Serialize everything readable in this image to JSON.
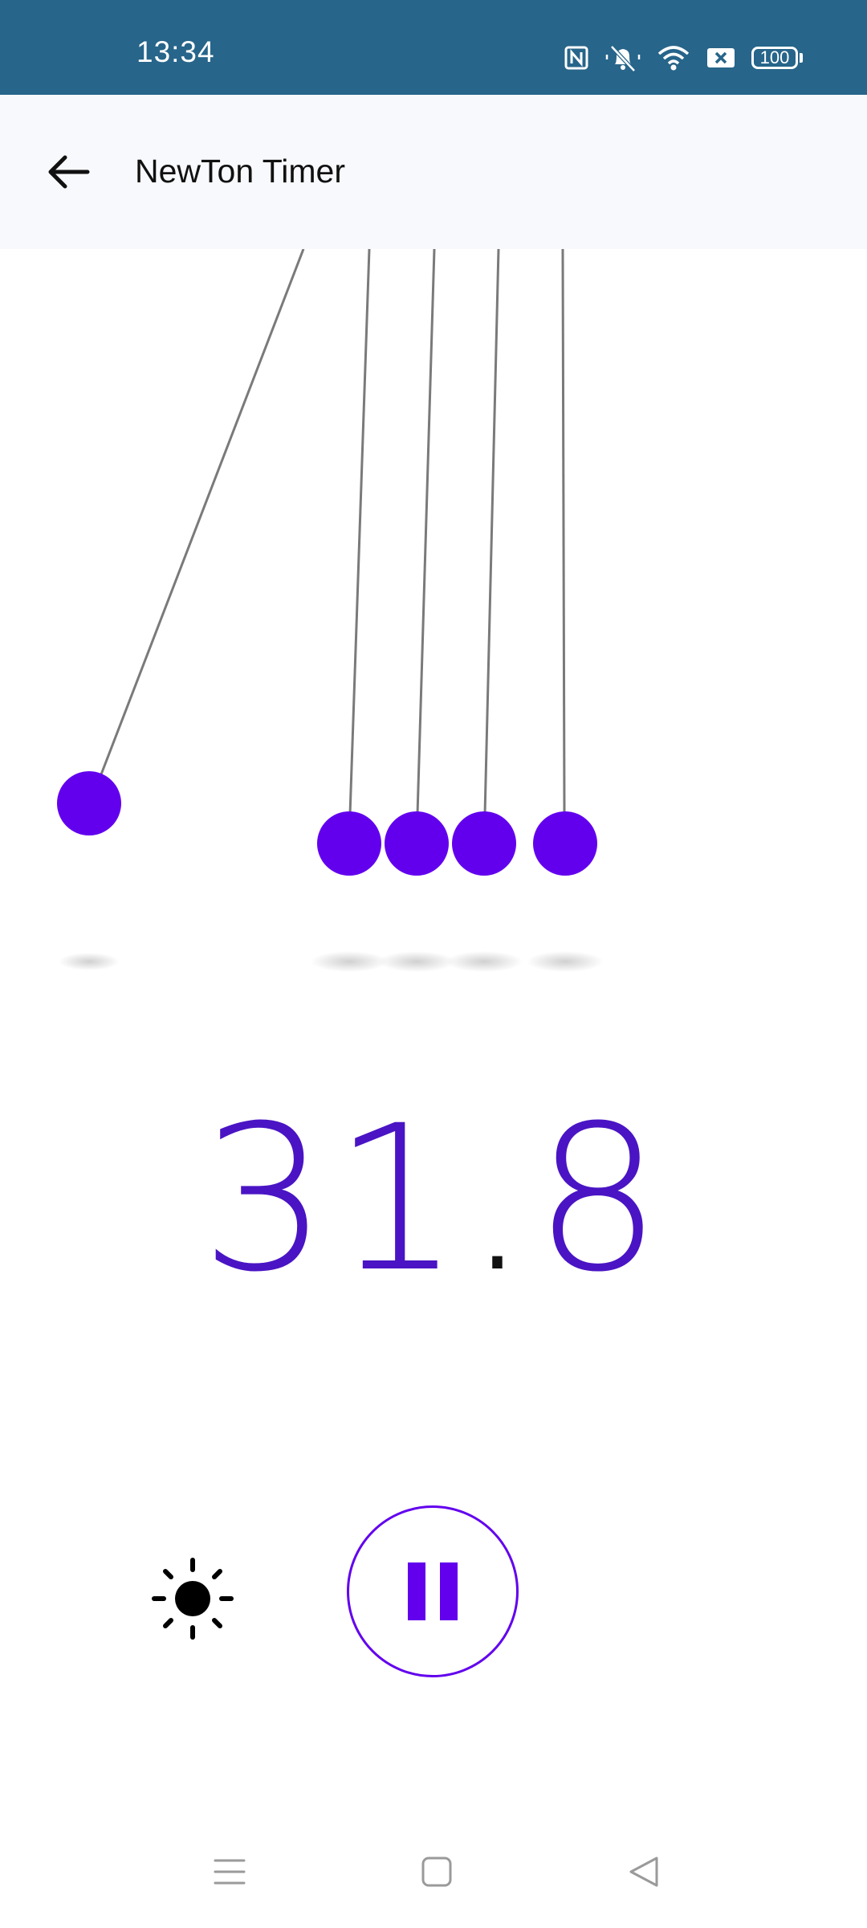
{
  "status_bar": {
    "time": "13:34",
    "battery": "100",
    "icons": [
      "nfc-icon",
      "silent-bell-icon",
      "wifi-icon",
      "sim-x-icon",
      "battery-icon"
    ],
    "background": "#27658a"
  },
  "app_bar": {
    "title": "NewTon Timer",
    "back_icon": "arrow-left-icon"
  },
  "timer": {
    "whole": "31",
    "separator": ".",
    "fraction": "8",
    "color": "#4a14c4"
  },
  "controls": {
    "brightness_icon": "sun-icon",
    "pause_icon": "pause-icon",
    "accent": "#6200ee"
  },
  "pendulum": {
    "ball_color": "#6200ee",
    "ball_count": 5
  },
  "nav_bar": {
    "items": [
      "menu-icon",
      "home-square-icon",
      "back-triangle-icon"
    ]
  }
}
